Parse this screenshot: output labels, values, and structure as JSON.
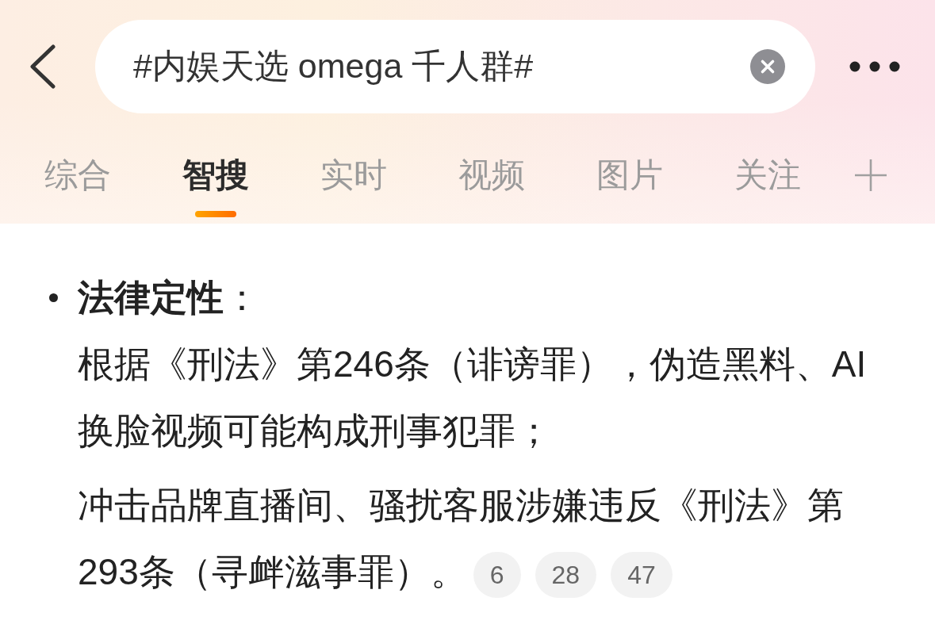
{
  "header": {
    "search": {
      "value": "#内娱天选 omega 千人群#"
    },
    "tabs": [
      {
        "label": "综合",
        "selected": false
      },
      {
        "label": "智搜",
        "selected": true
      },
      {
        "label": "实时",
        "selected": false
      },
      {
        "label": "视频",
        "selected": false
      },
      {
        "label": "图片",
        "selected": false
      },
      {
        "label": "关注",
        "selected": false
      }
    ]
  },
  "content": {
    "sections": [
      {
        "heading": "**法律定性**：",
        "paragraphs": [
          {
            "text": "根据《刑法》第246条（诽谤罪），伪造黑料、AI换脸视频可能构成刑事犯罪；"
          },
          {
            "text": "冲击品牌直播间、骚扰客服涉嫌违反《刑法》第293条（寻衅滋事罪）。",
            "citations": [
              "6",
              "28",
              "47"
            ]
          }
        ]
      }
    ]
  }
}
